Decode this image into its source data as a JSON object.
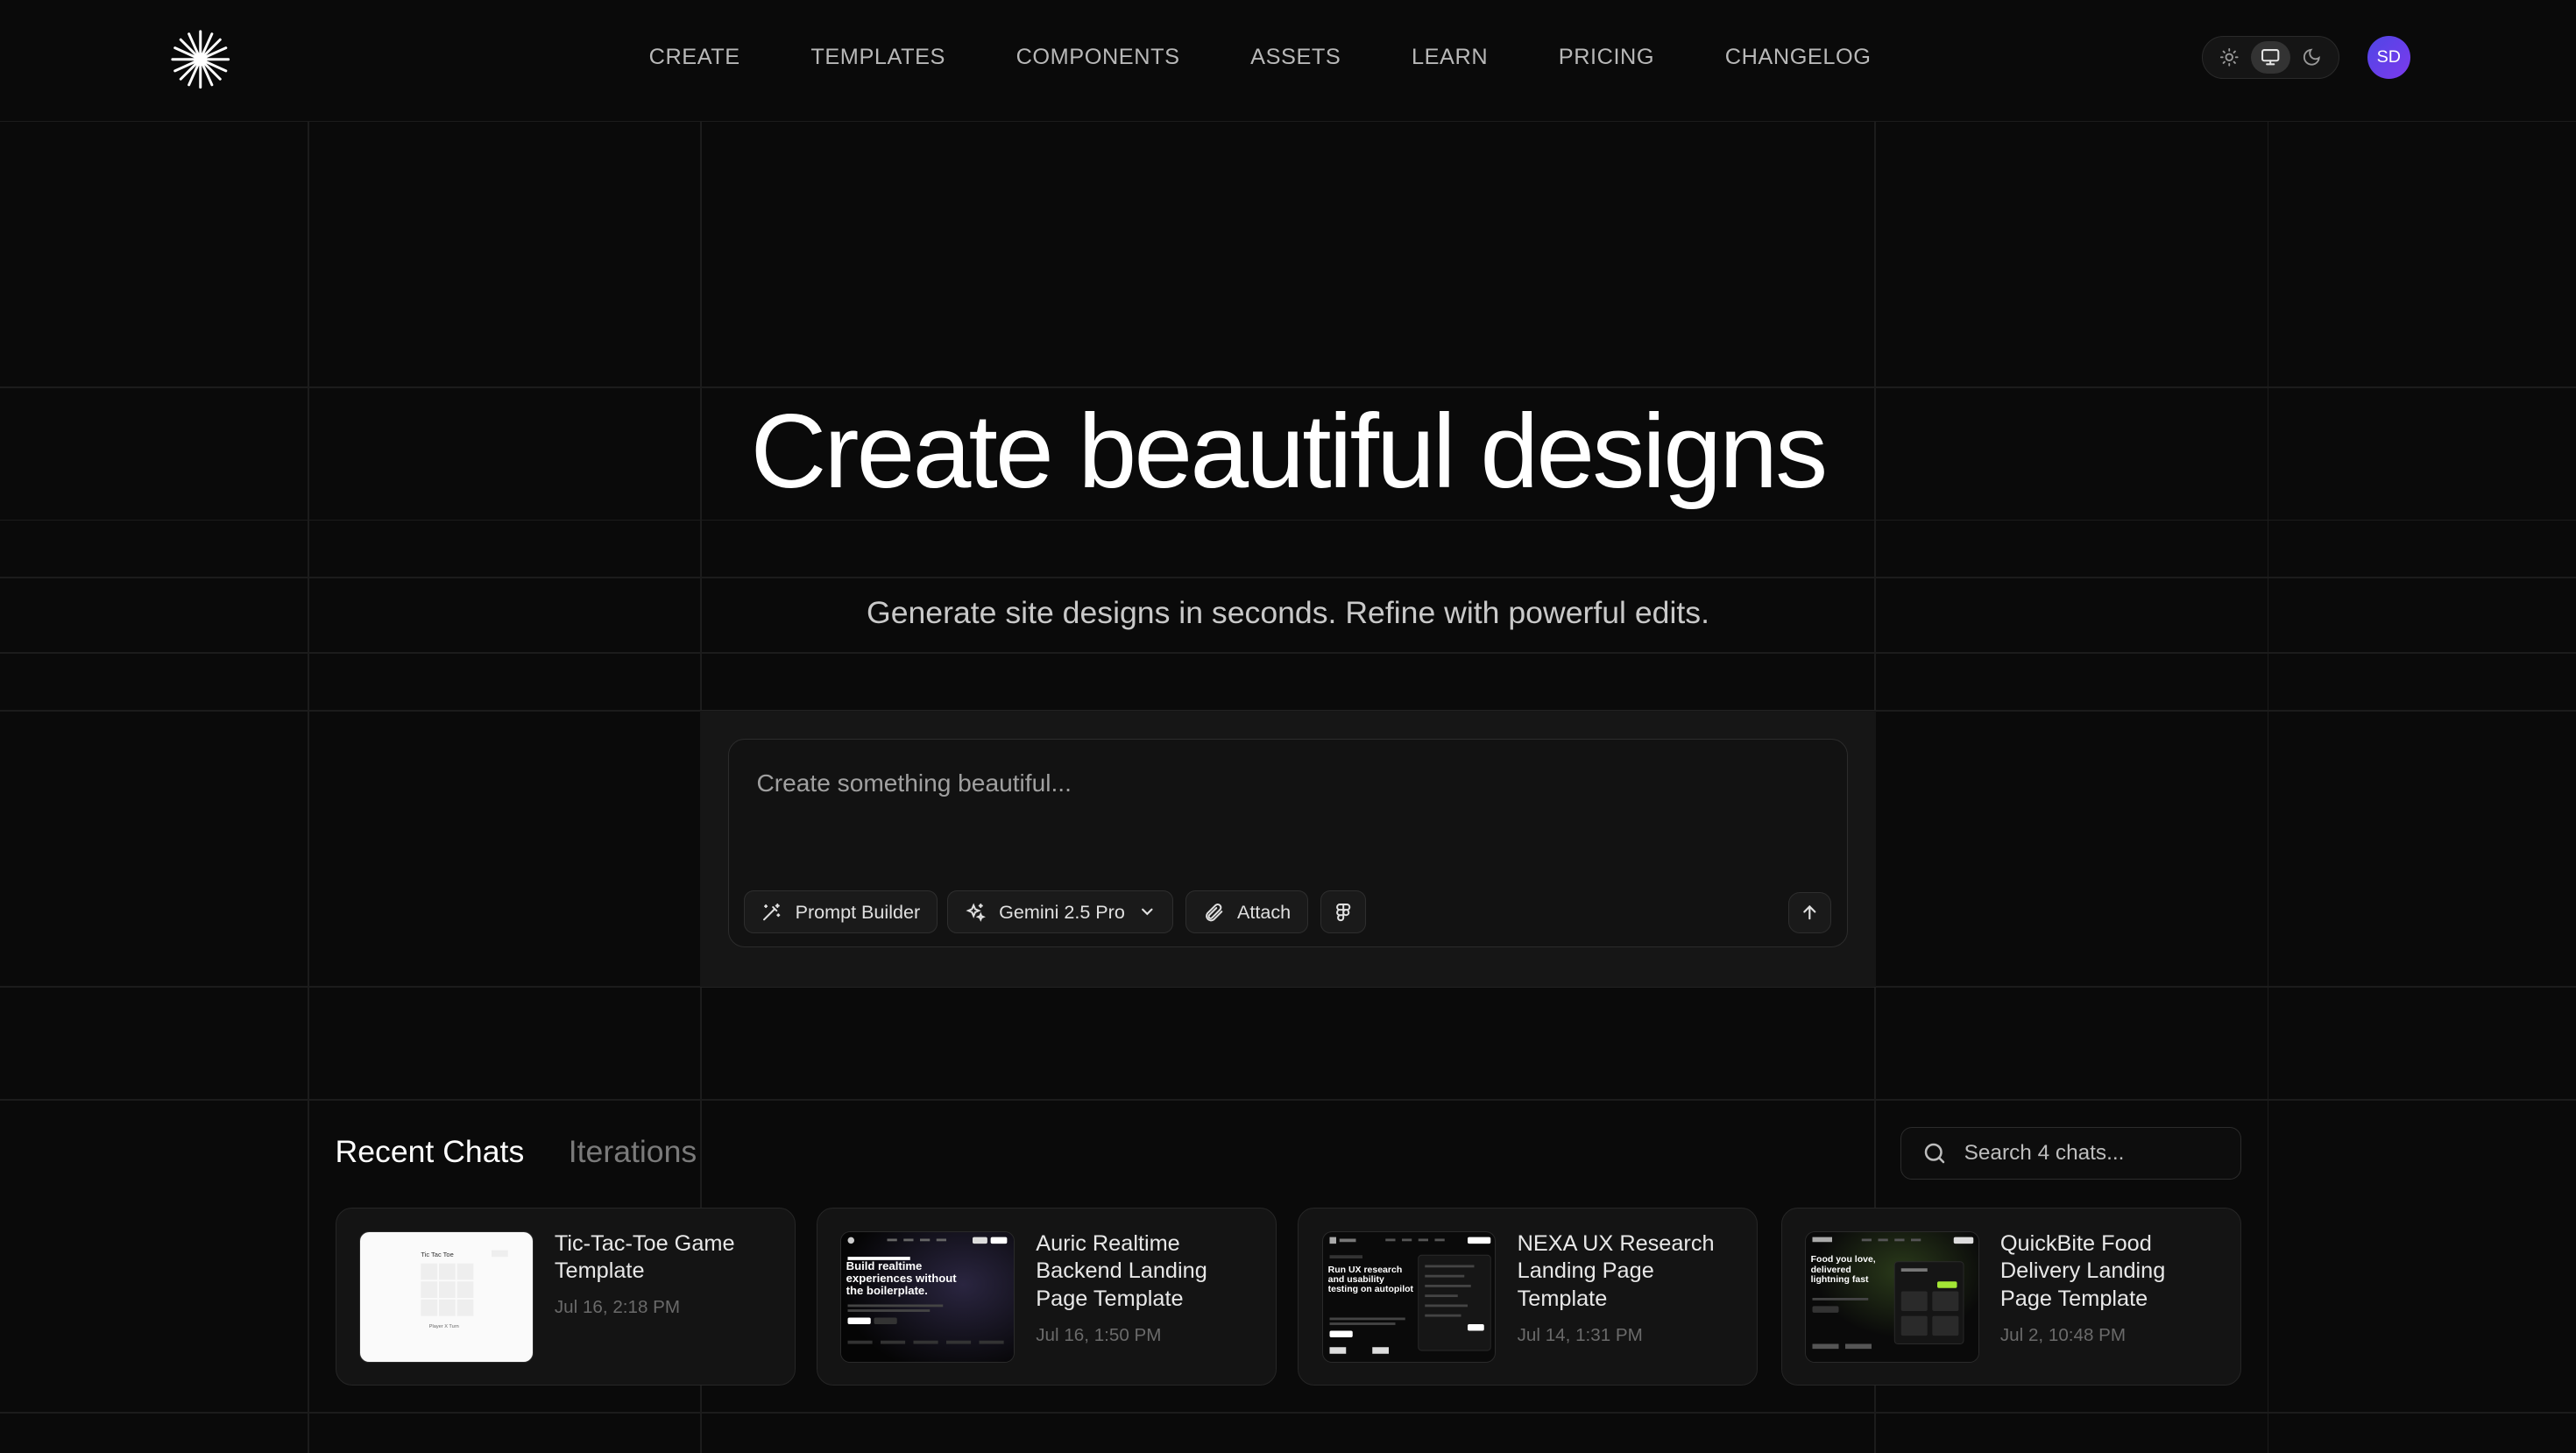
{
  "nav": {
    "items": [
      "CREATE",
      "TEMPLATES",
      "COMPONENTS",
      "ASSETS",
      "LEARN",
      "PRICING",
      "CHANGELOG"
    ]
  },
  "user": {
    "initials": "SD"
  },
  "theme": {
    "options": [
      "sun-icon",
      "monitor-icon",
      "moon-icon"
    ],
    "selected": "monitor-icon"
  },
  "hero": {
    "title": "Create beautiful designs",
    "subtitle": "Generate site designs in seconds. Refine with powerful edits."
  },
  "prompt": {
    "placeholder": "Create something beautiful...",
    "prompt_builder_label": "Prompt Builder",
    "model_label": "Gemini 2.5 Pro",
    "attach_label": "Attach"
  },
  "recent": {
    "tab_active": "Recent Chats",
    "tab_inactive": "Iterations",
    "search_placeholder": "Search 4 chats...",
    "cards": [
      {
        "title": "Tic-Tac-Toe Game Template",
        "date": "Jul 16, 2:18 PM"
      },
      {
        "title": "Auric Realtime Backend Landing Page Template",
        "date": "Jul 16, 1:50 PM"
      },
      {
        "title": "NEXA UX Research Landing Page Template",
        "date": "Jul 14, 1:31 PM"
      },
      {
        "title": "QuickBite Food Delivery Landing Page Template",
        "date": "Jul 2, 10:48 PM"
      }
    ]
  },
  "thumbs": {
    "auric": {
      "headline": "Build realtime experiences without the boilerplate."
    },
    "nexa": {
      "headline": "Run UX research and usability testing on autopilot"
    },
    "quickbite": {
      "headline": "Food you love, delivered lightning fast"
    },
    "tictactoe": {
      "title": "Tic Tac Toe",
      "footer": "Player X Turn"
    }
  },
  "colors": {
    "avatar": "#5b3fe0",
    "background": "#0a0a0a",
    "accent_green": "#a3e635"
  }
}
